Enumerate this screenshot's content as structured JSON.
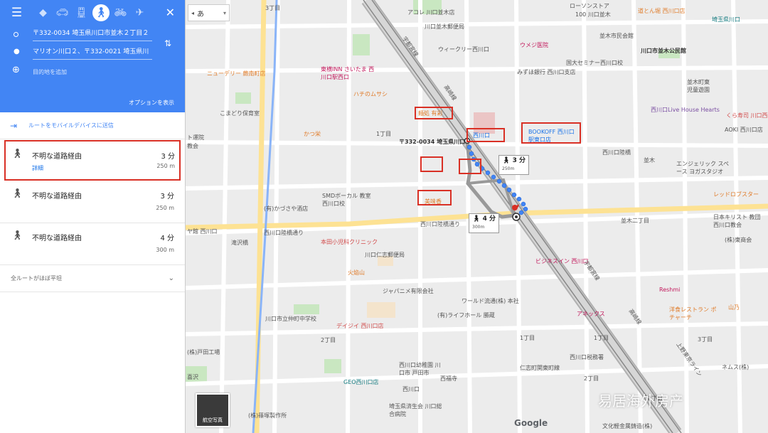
{
  "sidebar": {
    "origin": "〒332-0034 埼玉県川口市並木２丁目２",
    "destination": "マリオン川口２、〒332-0021 埼玉県川",
    "add_destination": "目的地を追加",
    "options": "オプションを表示",
    "send_to_mobile": "ルートをモバイルデバイスに送信",
    "routes": [
      {
        "title": "不明な道路経由",
        "duration": "3 分",
        "distance": "250 m",
        "detail": "詳細"
      },
      {
        "title": "不明な道路経由",
        "duration": "3 分",
        "distance": "250 m"
      },
      {
        "title": "不明な道路経由",
        "duration": "4 分",
        "distance": "300 m"
      }
    ],
    "summary": "全ルートがほぼ平坦"
  },
  "map": {
    "ime_label": "あ",
    "callout_primary": {
      "duration": "3 分",
      "distance": "250m"
    },
    "callout_alt": {
      "duration": "4 分",
      "distance": "300m"
    },
    "satellite_label": "航空写真",
    "google": "Google",
    "watermark": "易居海外房产",
    "labels": {
      "l1": "3丁目",
      "l2": "アコレ 川口並木店",
      "l3": "ローソンストア",
      "l4": "100 川口並木",
      "l5": "並木元町公園",
      "l6": "埼玉県川口",
      "l7": "道とん堀 西川口店",
      "l8": "川口並木郵便局",
      "l9": "川口並木郵便局",
      "l10": "並木市民会館",
      "l11": "ウィークリー西川口",
      "l12": "ウメジ医院",
      "l13": "川口市並木公民館",
      "l14": "国大セミナー西川口校",
      "l15": "みずほ銀行 西川口支店",
      "l16": "ニューデリー 蕨南町店",
      "l17": "東横INN さいたま 西川口駅西口",
      "l18": "ハチのムサシ",
      "l19": "並木町東 児童遊園",
      "l20": "こまどり保育室",
      "l21": "かつ栄",
      "l22": "1丁目",
      "l23": "麺処 有彩",
      "l24": "西川口",
      "l25": "〒332-0034 埼玉県川口",
      "l26": "BOOKOFF 西川口駅東口店",
      "l27": "西川口Live House Hearts",
      "l28": "くら寿司 川口西口店",
      "l29": "AOKI 西川口店",
      "l30": "西川口陸橋",
      "l31": "並木",
      "l32": "エンジェリック スペース ヨガスタジオ",
      "l33": "SMDボーカル 教室 西川口校",
      "l34": "(有)かづさや酒店",
      "l35": "西川口陸橋通り",
      "l36": "美味香",
      "l37": "レッドロブスター",
      "l38": "日本キリスト 教団西川口教会",
      "l39": "ヤ館 西川口",
      "l40": "西川口陸橋通り",
      "l41": "本田小児科クリニック",
      "l42": "川口仁志郵便局",
      "l43": "(株)東商会",
      "l44": "並木二丁目",
      "l45": "ビジネスイン 西川口",
      "l46": "火焔山",
      "l47": "ジャパニメ有限会社",
      "l48": "ワールド流通(株) 本社",
      "l49": "Reshmi",
      "l50": "アネックス",
      "l51": "洋食レストラン ポチャーチ",
      "l52": "山乃",
      "l53": "川口市立仲町中学校",
      "l54": "デイジイ 西川口店",
      "l55": "(有)ライフホール 勝蔵",
      "l56": "2丁目",
      "l57": "西川口税務署",
      "l58": "仁志町関東町線",
      "l59": "(株)戸田工場",
      "l60": "西川口幼稚園 川口市 戸田市",
      "l61": "西福寺",
      "l62": "GEO西川口店",
      "l63": "西川口",
      "l64": "(株)篠塚製作所",
      "l65": "埼玉県済生会 川口総合病院",
      "l66": "ネムス(株)",
      "l67": "文化軽金属鋳造(株)",
      "l68": "西川口自動車道",
      "l69": "1丁目",
      "l70": "2丁目",
      "l71": "3丁目",
      "l72": "1丁目",
      "l73": "3丁目",
      "l74": "滝沢橋",
      "l75": "京浜東北線",
      "l76": "高崎線",
      "l77": "宇都宮線",
      "l78": "上野東京ライン",
      "l79": "宇都宮線",
      "l80": "高崎線",
      "l81": "北口",
      "l82": "ト運院",
      "l83": "教会",
      "l84": "ア川",
      "l85": "喜沢",
      "l86": "西川口",
      "l87": "並木町",
      "l88": "2丁目",
      "l89": "川口",
      "l90": "西川口陸橋通り"
    }
  }
}
